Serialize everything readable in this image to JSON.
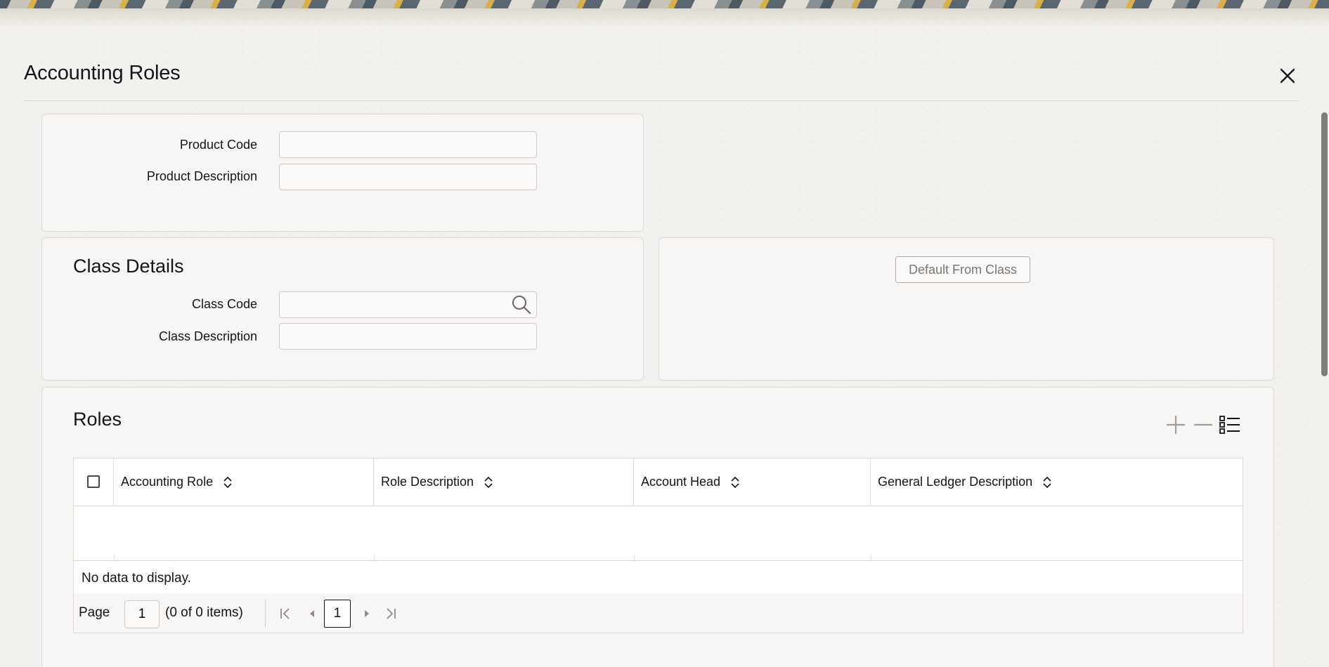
{
  "window": {
    "title": "Accounting Roles"
  },
  "product": {
    "code_label": "Product Code",
    "code_value": "",
    "description_label": "Product Description",
    "description_value": ""
  },
  "class_details": {
    "title": "Class Details",
    "code_label": "Class Code",
    "code_value": "",
    "description_label": "Class Description",
    "description_value": "",
    "default_button_label": "Default From Class"
  },
  "roles": {
    "title": "Roles",
    "columns": [
      "Accounting Role",
      "Role Description",
      "Account Head",
      "General Ledger Description"
    ],
    "rows": [],
    "empty_message": "No data to display.",
    "pager": {
      "page_label": "Page",
      "page_value": "1",
      "count_text": "(0 of 0 items)",
      "current_page": "1"
    }
  },
  "icons": {
    "close": "close-icon",
    "search": "search-icon",
    "add": "plus-icon",
    "remove": "minus-icon",
    "columns": "list-view-icon",
    "sort": "sort-icon",
    "first": "first-page-icon",
    "prev": "previous-page-icon",
    "next": "next-page-icon",
    "last": "last-page-icon"
  },
  "colors": {
    "background": "#f3f1ee",
    "panel": "#f7f6f4",
    "text": "#161513",
    "border": "#dedad4",
    "button_text": "#7a7772"
  }
}
